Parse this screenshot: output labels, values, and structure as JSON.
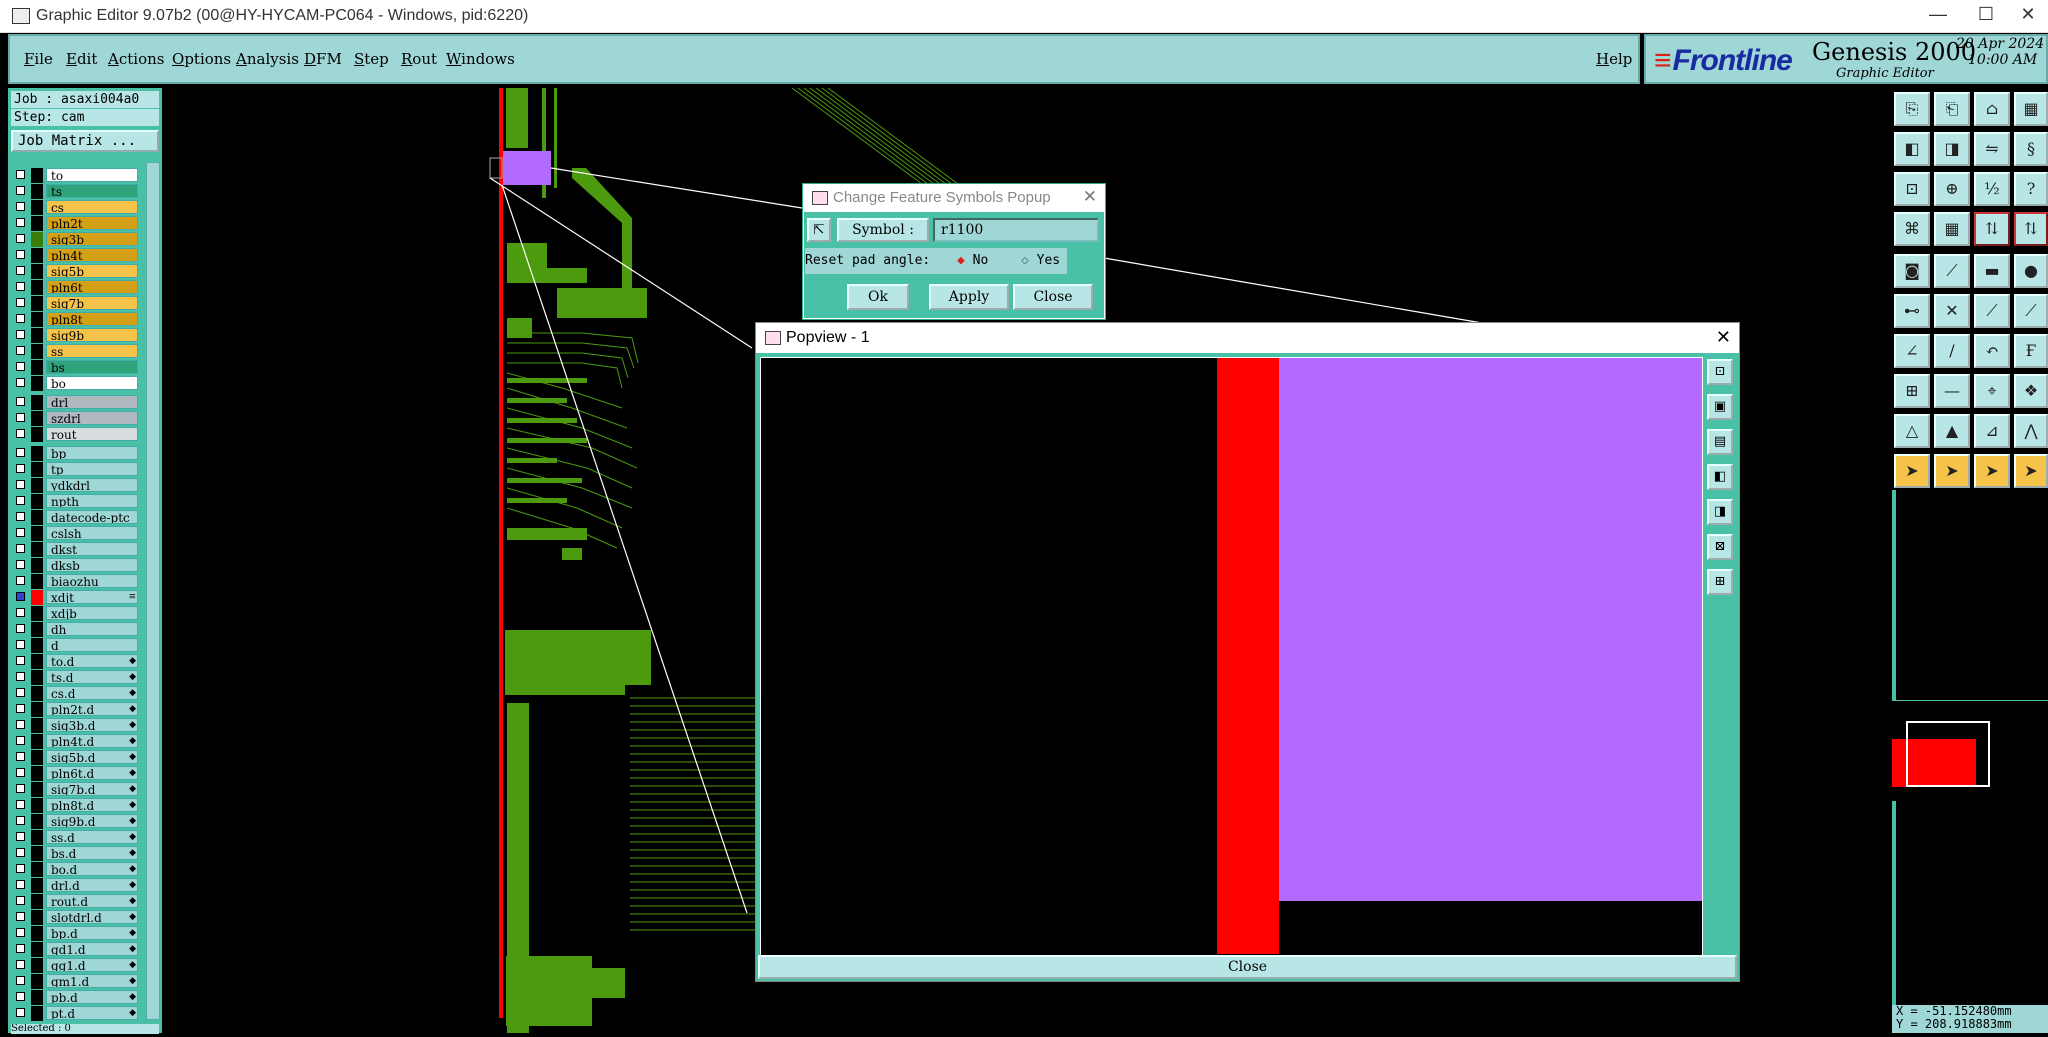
{
  "window": {
    "title": "Graphic Editor 9.07b2 (00@HY-HYCAM-PC064 - Windows, pid:6220)",
    "controls": [
      "—",
      "☐",
      "✕"
    ]
  },
  "menu": {
    "items": [
      "File",
      "Edit",
      "Actions",
      "Options",
      "Analysis",
      "DFM",
      "Step",
      "Rout",
      "Windows"
    ],
    "help": "Help"
  },
  "brand": {
    "logo": "Frontline",
    "product": "Genesis 2000",
    "subtitle": "Graphic Editor",
    "date": "20 Apr 2024",
    "time": "10:00 AM"
  },
  "job": {
    "job_label": "Job : asaxi004a0",
    "step_label": "Step: cam",
    "matrix_button": "Job Matrix ..."
  },
  "layers": [
    {
      "name": "to",
      "bg": "#ffffff",
      "sw": "#000000"
    },
    {
      "name": "ts",
      "bg": "#2fa37a",
      "sw": "#000000"
    },
    {
      "name": "cs",
      "bg": "#f5c24a",
      "sw": "#000000"
    },
    {
      "name": "pln2t",
      "bg": "#d4a017",
      "sw": "#000000"
    },
    {
      "name": "sig3b",
      "bg": "#d4a017",
      "sw": "#3a7d0a"
    },
    {
      "name": "pln4t",
      "bg": "#d4a017",
      "sw": "#000000"
    },
    {
      "name": "sig5b",
      "bg": "#f5c24a",
      "sw": "#000000"
    },
    {
      "name": "pln6t",
      "bg": "#d4a017",
      "sw": "#000000"
    },
    {
      "name": "sig7b",
      "bg": "#f5c24a",
      "sw": "#000000"
    },
    {
      "name": "pln8t",
      "bg": "#d4a017",
      "sw": "#000000"
    },
    {
      "name": "sig9b",
      "bg": "#f5c24a",
      "sw": "#000000"
    },
    {
      "name": "ss",
      "bg": "#f5c24a",
      "sw": "#000000"
    },
    {
      "name": "bs",
      "bg": "#2fa37a",
      "sw": "#000000"
    },
    {
      "name": "bo",
      "bg": "#ffffff",
      "sw": "#000000"
    },
    {
      "name": "drl",
      "bg": "#b0b8c0",
      "sw": "#000000",
      "gap": true
    },
    {
      "name": "szdrl",
      "bg": "#b0b8c0",
      "sw": "#000000"
    },
    {
      "name": "rout",
      "bg": "#d8dde0",
      "sw": "#000000"
    },
    {
      "name": "bp",
      "bg": "#9fd6d6",
      "sw": "#000000",
      "gap": true
    },
    {
      "name": "tp",
      "bg": "#9fd6d6",
      "sw": "#000000"
    },
    {
      "name": "ydkdrl",
      "bg": "#9fd6d6",
      "sw": "#000000"
    },
    {
      "name": "npth",
      "bg": "#9fd6d6",
      "sw": "#000000"
    },
    {
      "name": "datecode-ptc",
      "bg": "#9fd6d6",
      "sw": "#000000"
    },
    {
      "name": "cslsh",
      "bg": "#9fd6d6",
      "sw": "#000000"
    },
    {
      "name": "dkst",
      "bg": "#9fd6d6",
      "sw": "#000000"
    },
    {
      "name": "dksb",
      "bg": "#9fd6d6",
      "sw": "#000000"
    },
    {
      "name": "biaozhu",
      "bg": "#9fd6d6",
      "sw": "#000000"
    },
    {
      "name": "xdjt",
      "bg": "#9fd6d6",
      "sw": "#ff0000",
      "mark": "≡",
      "active": true
    },
    {
      "name": "xdjb",
      "bg": "#9fd6d6",
      "sw": "#000000"
    },
    {
      "name": "dh",
      "bg": "#9fd6d6",
      "sw": "#000000"
    },
    {
      "name": "d",
      "bg": "#9fd6d6",
      "sw": "#000000"
    },
    {
      "name": "to.d",
      "bg": "#9fd6d6",
      "sw": "#000000",
      "mark": "◆"
    },
    {
      "name": "ts.d",
      "bg": "#9fd6d6",
      "sw": "#000000",
      "mark": "◆"
    },
    {
      "name": "cs.d",
      "bg": "#9fd6d6",
      "sw": "#000000",
      "mark": "◆"
    },
    {
      "name": "pln2t.d",
      "bg": "#9fd6d6",
      "sw": "#000000",
      "mark": "◆"
    },
    {
      "name": "sig3b.d",
      "bg": "#9fd6d6",
      "sw": "#000000",
      "mark": "◆"
    },
    {
      "name": "pln4t.d",
      "bg": "#9fd6d6",
      "sw": "#000000",
      "mark": "◆"
    },
    {
      "name": "sig5b.d",
      "bg": "#9fd6d6",
      "sw": "#000000",
      "mark": "◆"
    },
    {
      "name": "pln6t.d",
      "bg": "#9fd6d6",
      "sw": "#000000",
      "mark": "◆"
    },
    {
      "name": "sig7b.d",
      "bg": "#9fd6d6",
      "sw": "#000000",
      "mark": "◆"
    },
    {
      "name": "pln8t.d",
      "bg": "#9fd6d6",
      "sw": "#000000",
      "mark": "◆"
    },
    {
      "name": "sig9b.d",
      "bg": "#9fd6d6",
      "sw": "#000000",
      "mark": "◆"
    },
    {
      "name": "ss.d",
      "bg": "#9fd6d6",
      "sw": "#000000",
      "mark": "◆"
    },
    {
      "name": "bs.d",
      "bg": "#9fd6d6",
      "sw": "#000000",
      "mark": "◆"
    },
    {
      "name": "bo.d",
      "bg": "#9fd6d6",
      "sw": "#000000",
      "mark": "◆"
    },
    {
      "name": "drl.d",
      "bg": "#9fd6d6",
      "sw": "#000000",
      "mark": "◆"
    },
    {
      "name": "rout.d",
      "bg": "#9fd6d6",
      "sw": "#000000",
      "mark": "◆"
    },
    {
      "name": "slotdrl.d",
      "bg": "#9fd6d6",
      "sw": "#000000",
      "mark": "◆"
    },
    {
      "name": "bp.d",
      "bg": "#9fd6d6",
      "sw": "#000000",
      "mark": "◆"
    },
    {
      "name": "gd1.d",
      "bg": "#9fd6d6",
      "sw": "#000000",
      "mark": "◆"
    },
    {
      "name": "gg1.d",
      "bg": "#9fd6d6",
      "sw": "#000000",
      "mark": "◆"
    },
    {
      "name": "gm1.d",
      "bg": "#9fd6d6",
      "sw": "#000000",
      "mark": "◆"
    },
    {
      "name": "pb.d",
      "bg": "#9fd6d6",
      "sw": "#000000",
      "mark": "◆"
    },
    {
      "name": "pt.d",
      "bg": "#9fd6d6",
      "sw": "#000000",
      "mark": "◆"
    }
  ],
  "status": {
    "selected": "Selected : 0"
  },
  "cfs_dialog": {
    "title": "Change Feature Symbols Popup",
    "symbol_label": "Symbol :",
    "symbol_value": "r1100",
    "reset_label": "Reset pad angle:",
    "option_no": "No",
    "option_yes": "Yes",
    "ok": "Ok",
    "apply": "Apply",
    "close": "Close"
  },
  "popview": {
    "title": "Popview - 1",
    "close": "Close"
  },
  "coords": {
    "x": "X = -51.152480mm",
    "y": "Y = 208.918883mm"
  },
  "colors": {
    "panel": "#49c1a6",
    "light": "#9fd6d6",
    "trace": "#4c9a0e",
    "pad": "#b36bff",
    "red": "#ff0000"
  }
}
